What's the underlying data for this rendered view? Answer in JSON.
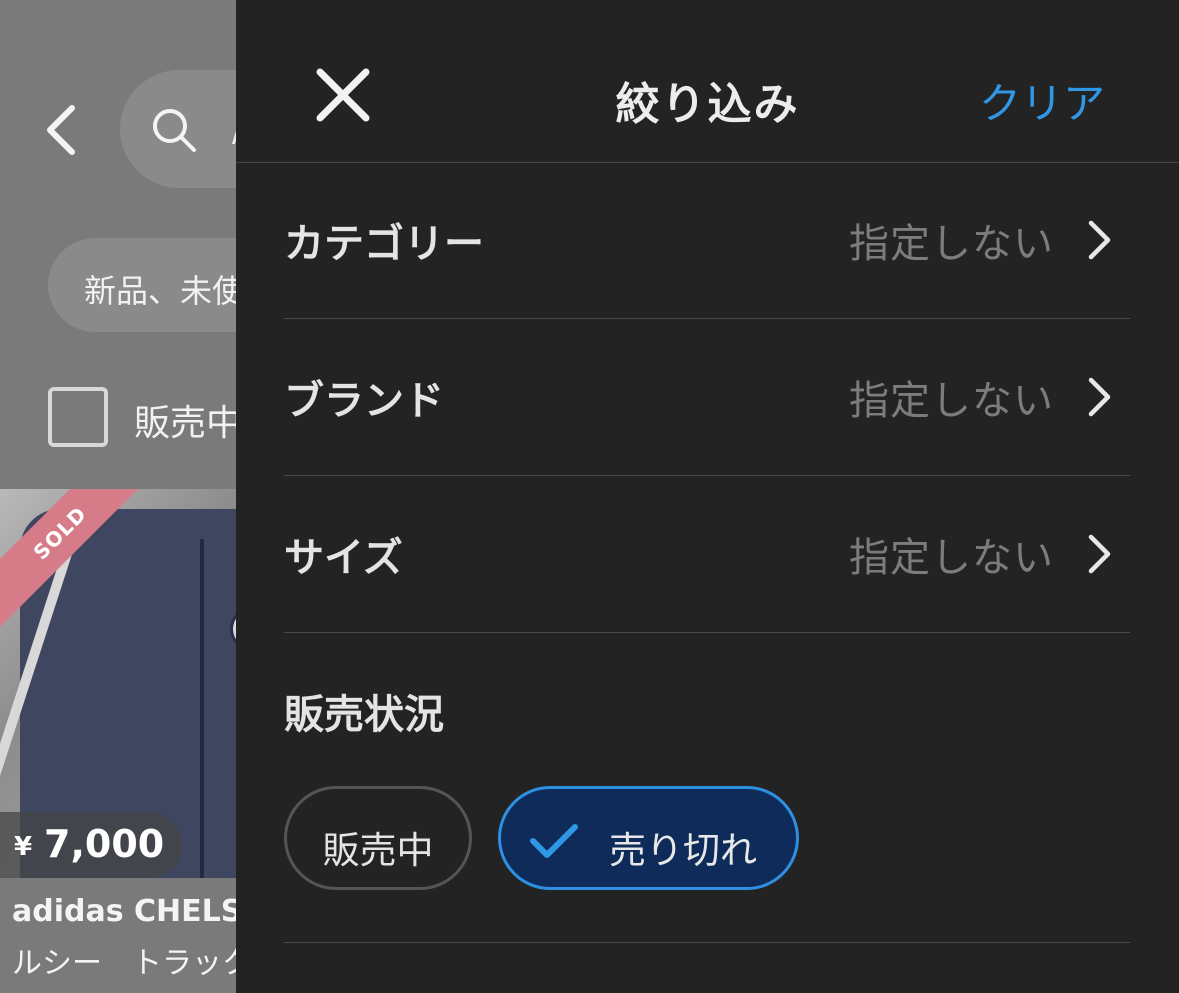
{
  "background": {
    "search_partial": "/",
    "condition_chip": "新品、未使",
    "checkbox_label": "販売中",
    "product": {
      "badge": "SOLD",
      "currency": "¥",
      "price": "7,000",
      "title_line1": "adidas CHELS",
      "title_line2": "ルシー　トラック"
    }
  },
  "drawer": {
    "title": "絞り込み",
    "clear_label": "クリア",
    "filters": [
      {
        "label": "カテゴリー",
        "value": "指定しない"
      },
      {
        "label": "ブランド",
        "value": "指定しない"
      },
      {
        "label": "サイズ",
        "value": "指定しない"
      }
    ],
    "sales_status": {
      "title": "販売状況",
      "options": [
        {
          "label": "販売中",
          "selected": false
        },
        {
          "label": "売り切れ",
          "selected": true
        }
      ]
    }
  },
  "colors": {
    "accent": "#2f97e6",
    "selected_bg": "#0e2b5a",
    "drawer_bg": "#232323",
    "sold_badge": "#d67c88"
  }
}
